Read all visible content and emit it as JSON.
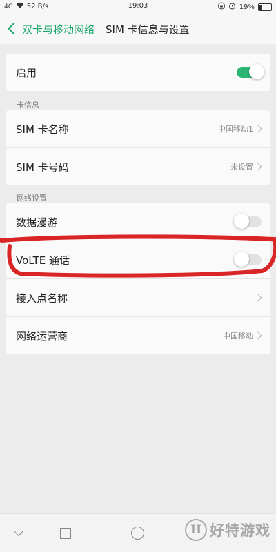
{
  "status_bar": {
    "signal": "4G",
    "net_speed": "52 B/s",
    "time": "19:03",
    "battery": "19%",
    "battery_level": 0.19
  },
  "header": {
    "back_label": "双卡与移动网络",
    "title": "SIM 卡信息与设置"
  },
  "enable_row": {
    "label": "启用",
    "toggle_on": true
  },
  "card_info": {
    "section_title": "卡信息",
    "items": [
      {
        "label": "SIM 卡名称",
        "value": "中国移动1"
      },
      {
        "label": "SIM 卡号码",
        "value": "未设置"
      }
    ]
  },
  "network": {
    "section_title": "网络设置",
    "roaming": {
      "label": "数据漫游",
      "toggle_on": false
    },
    "volte": {
      "label": "VoLTE 通话",
      "toggle_on": false
    },
    "apn": {
      "label": "接入点名称"
    },
    "carrier": {
      "label": "网络运营商",
      "value": "中国移动"
    }
  },
  "watermark": {
    "logo": "H",
    "text": "好特游戏"
  },
  "colors": {
    "accent": "#1ba76a",
    "toggle_on": "#2bb673",
    "annotation": "#d92525"
  }
}
